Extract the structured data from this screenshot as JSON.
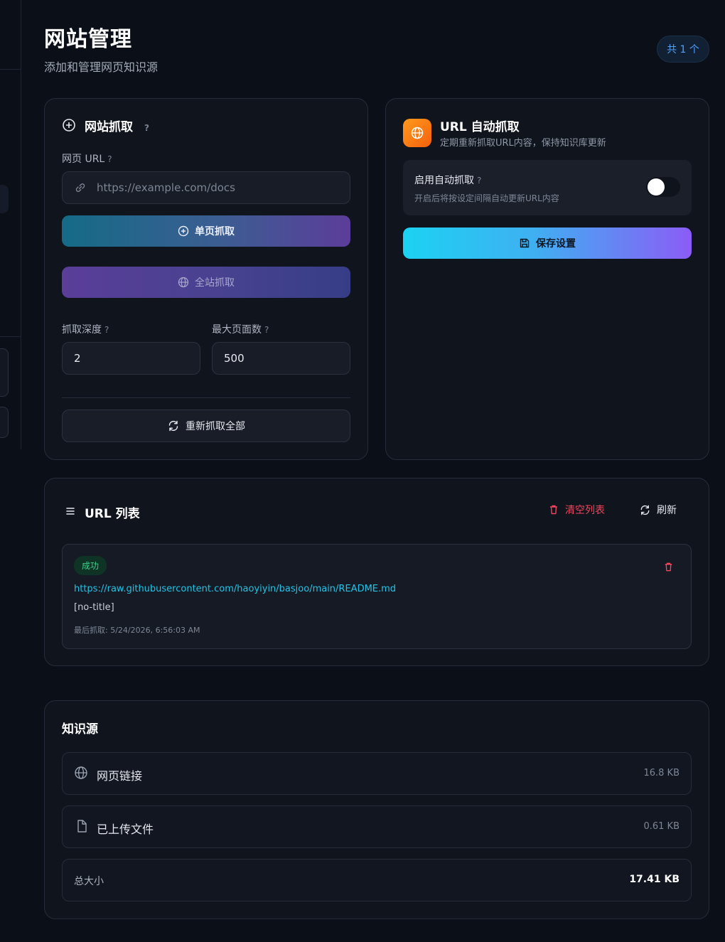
{
  "header": {
    "title": "网站管理",
    "subtitle": "添加和管理网页知识源",
    "count_badge": "共 1 个"
  },
  "crawl_card": {
    "title": "网站抓取",
    "help": "?",
    "url_label": "网页 URL",
    "url_placeholder": "https://example.com/docs",
    "single_button": "单页抓取",
    "site_button": "全站抓取",
    "depth_label": "抓取深度",
    "depth_value": "2",
    "max_pages_label": "最大页面数",
    "max_pages_value": "500",
    "recrawl_button": "重新抓取全部"
  },
  "auto_card": {
    "title": "URL 自动抓取",
    "subtitle": "定期重新抓取URL内容，保持知识库更新",
    "toggle_label": "启用自动抓取",
    "toggle_desc": "开启后将按设定间隔自动更新URL内容",
    "toggle_on": false,
    "save_button": "保存设置"
  },
  "url_list": {
    "title": "URL 列表",
    "clear_button": "清空列表",
    "refresh_button": "刷新",
    "items": [
      {
        "status": "成功",
        "url": "https://raw.githubusercontent.com/haoyiyin/basjoo/main/README.md",
        "title": "[no-title]",
        "last_crawled": "最后抓取: 5/24/2026, 6:56:03 AM"
      }
    ]
  },
  "sources": {
    "title": "知识源",
    "rows": [
      {
        "icon": "globe-icon",
        "label": "网页链接",
        "size": "16.8 KB"
      },
      {
        "icon": "file-icon",
        "label": "已上传文件",
        "size": "0.61 KB"
      }
    ],
    "total_label": "总大小",
    "total_size": "17.41 KB"
  },
  "colors": {
    "accent_blue": "#4ea1ff",
    "link": "#22c3e6",
    "danger": "#f0455c",
    "success": "#3ed08b",
    "gradient_save": [
      "#1fd1f0",
      "#8b5cf6"
    ]
  }
}
